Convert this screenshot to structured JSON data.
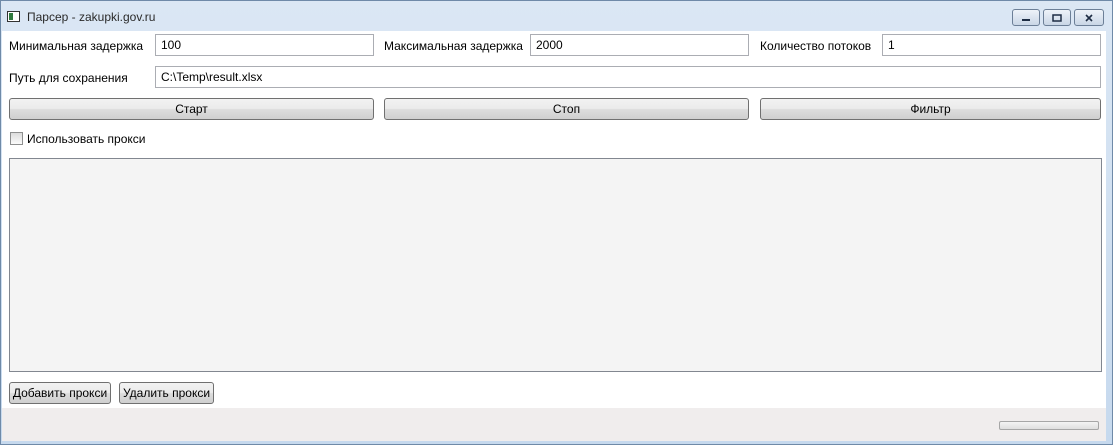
{
  "window": {
    "title": "Парсер - zakupki.gov.ru",
    "controls": [
      "minimize-icon",
      "maximize-icon",
      "close-icon"
    ]
  },
  "settings": {
    "min_delay_label": "Минимальная задержка",
    "min_delay_value": "100",
    "max_delay_label": "Максимальная задержка",
    "max_delay_value": "2000",
    "threads_label": "Количество потоков",
    "threads_value": "1",
    "save_path_label": "Путь для сохранения",
    "save_path_value": "C:\\Temp\\result.xlsx"
  },
  "actions": {
    "start_label": "Старт",
    "stop_label": "Стоп",
    "filter_label": "Фильтр"
  },
  "proxy": {
    "use_proxy_label": "Использовать прокси",
    "use_proxy_checked": false,
    "items": [],
    "add_label": "Добавить прокси",
    "remove_label": "Удалить прокси"
  },
  "status": {
    "progress_fraction": 0
  }
}
